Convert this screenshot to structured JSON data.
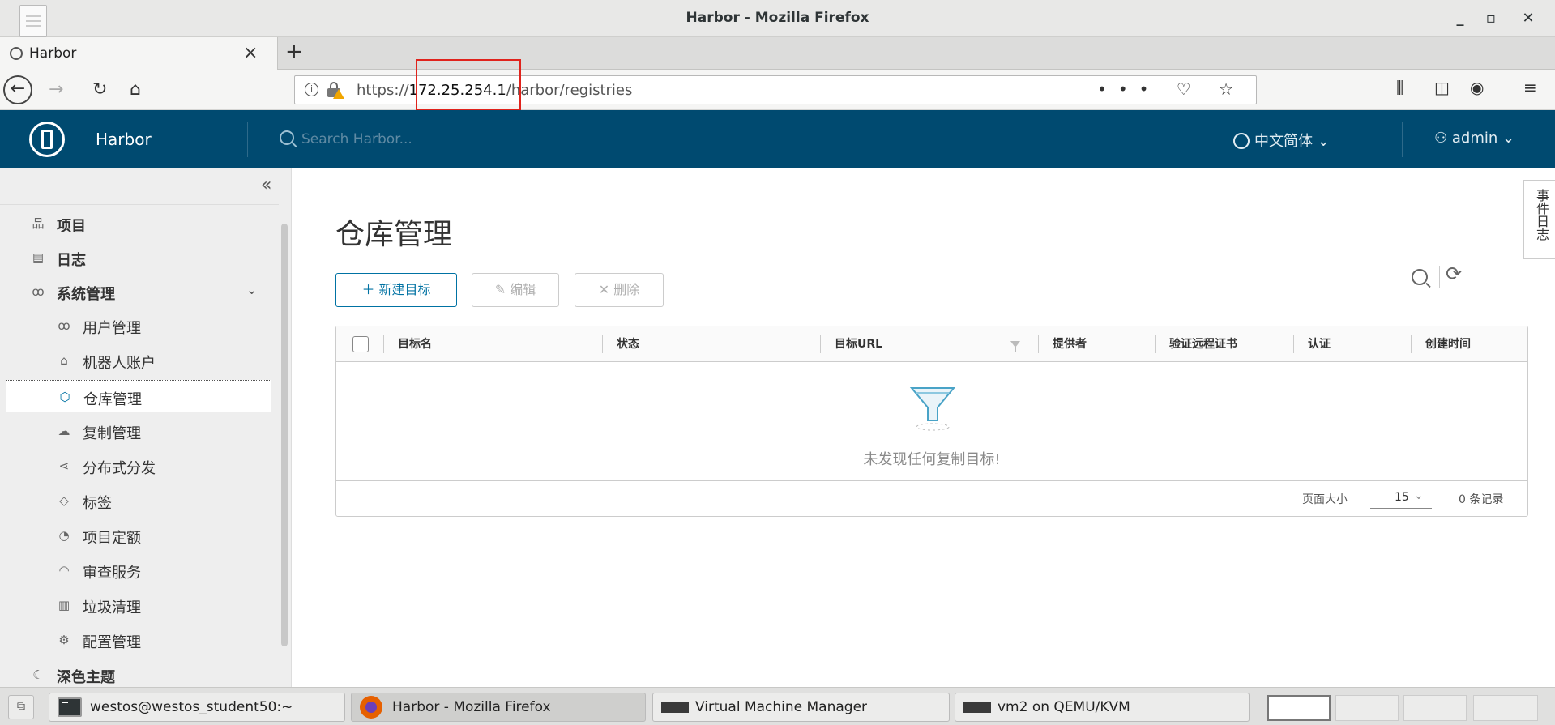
{
  "window": {
    "title": "Harbor - Mozilla Firefox",
    "minimize": "_",
    "maximize": "▫",
    "close": "✕"
  },
  "tabs": [
    {
      "label": "Harbor",
      "close": "×"
    }
  ],
  "new_tab": "+",
  "navbar": {
    "url_scheme": "https://",
    "url_host": "172.25.254.1",
    "url_path": "/harbor/registries",
    "url_actions": "••• ♡ ☆",
    "toolbar_icons": [
      "library-icon",
      "sidebar-icon",
      "account-icon",
      "menu-icon"
    ]
  },
  "harbor": {
    "brand": "Harbor",
    "search_placeholder": "Search Harbor...",
    "language": "中文简体 ⌄",
    "user": "admin ⌄"
  },
  "sidebar": {
    "collapse": "«",
    "items": [
      {
        "label": "项目",
        "icon": "projects-icon",
        "glyph": "品",
        "level": "top"
      },
      {
        "label": "日志",
        "icon": "logs-icon",
        "glyph": "▤",
        "level": "top"
      },
      {
        "label": "系统管理",
        "icon": "admin-icon",
        "glyph": "ꝏ",
        "level": "top",
        "expanded": true
      },
      {
        "label": "用户管理",
        "icon": "users-icon",
        "glyph": "ꝏ",
        "level": "sub"
      },
      {
        "label": "机器人账户",
        "icon": "robot-icon",
        "glyph": "⌂",
        "level": "sub"
      },
      {
        "label": "仓库管理",
        "icon": "registry-icon",
        "glyph": "⬡",
        "level": "sub",
        "active": true
      },
      {
        "label": "复制管理",
        "icon": "replication-icon",
        "glyph": "☁",
        "level": "sub"
      },
      {
        "label": "分布式分发",
        "icon": "distribution-icon",
        "glyph": "⋖",
        "level": "sub"
      },
      {
        "label": "标签",
        "icon": "tag-icon",
        "glyph": "◇",
        "level": "sub"
      },
      {
        "label": "项目定额",
        "icon": "quota-icon",
        "glyph": "◔",
        "level": "sub"
      },
      {
        "label": "审查服务",
        "icon": "shield-icon",
        "glyph": "◠",
        "level": "sub"
      },
      {
        "label": "垃圾清理",
        "icon": "trash-icon",
        "glyph": "▥",
        "level": "sub"
      },
      {
        "label": "配置管理",
        "icon": "gear-icon",
        "glyph": "⚙",
        "level": "sub"
      },
      {
        "label": "深色主题",
        "icon": "moon-icon",
        "glyph": "☾",
        "level": "top"
      }
    ]
  },
  "main": {
    "title": "仓库管理",
    "buttons": {
      "new": "＋ 新建目标",
      "edit": "✎ 编辑",
      "delete": "✕ 删除"
    },
    "refresh": "⟳",
    "columns": [
      "目标名",
      "状态",
      "目标URL",
      "提供者",
      "验证远程证书",
      "认证",
      "创建时间"
    ],
    "empty_text": "未发现任何复制目标!",
    "footer": {
      "page_size_label": "页面大小",
      "page_size_value": "15",
      "page_size_chevron": "⌄",
      "record_count": "0 条记录"
    },
    "event_log_tab": "事件日志"
  },
  "taskbar": {
    "show_desktop": "⧉",
    "items": [
      {
        "label": "westos@westos_student50:~",
        "icon": "terminal-icon"
      },
      {
        "label": "Harbor - Mozilla Firefox",
        "icon": "firefox-icon",
        "active": true
      },
      {
        "label": "Virtual Machine Manager",
        "icon": "vmm-icon"
      },
      {
        "label": "vm2 on QEMU/KVM",
        "icon": "vmm-icon"
      }
    ]
  }
}
